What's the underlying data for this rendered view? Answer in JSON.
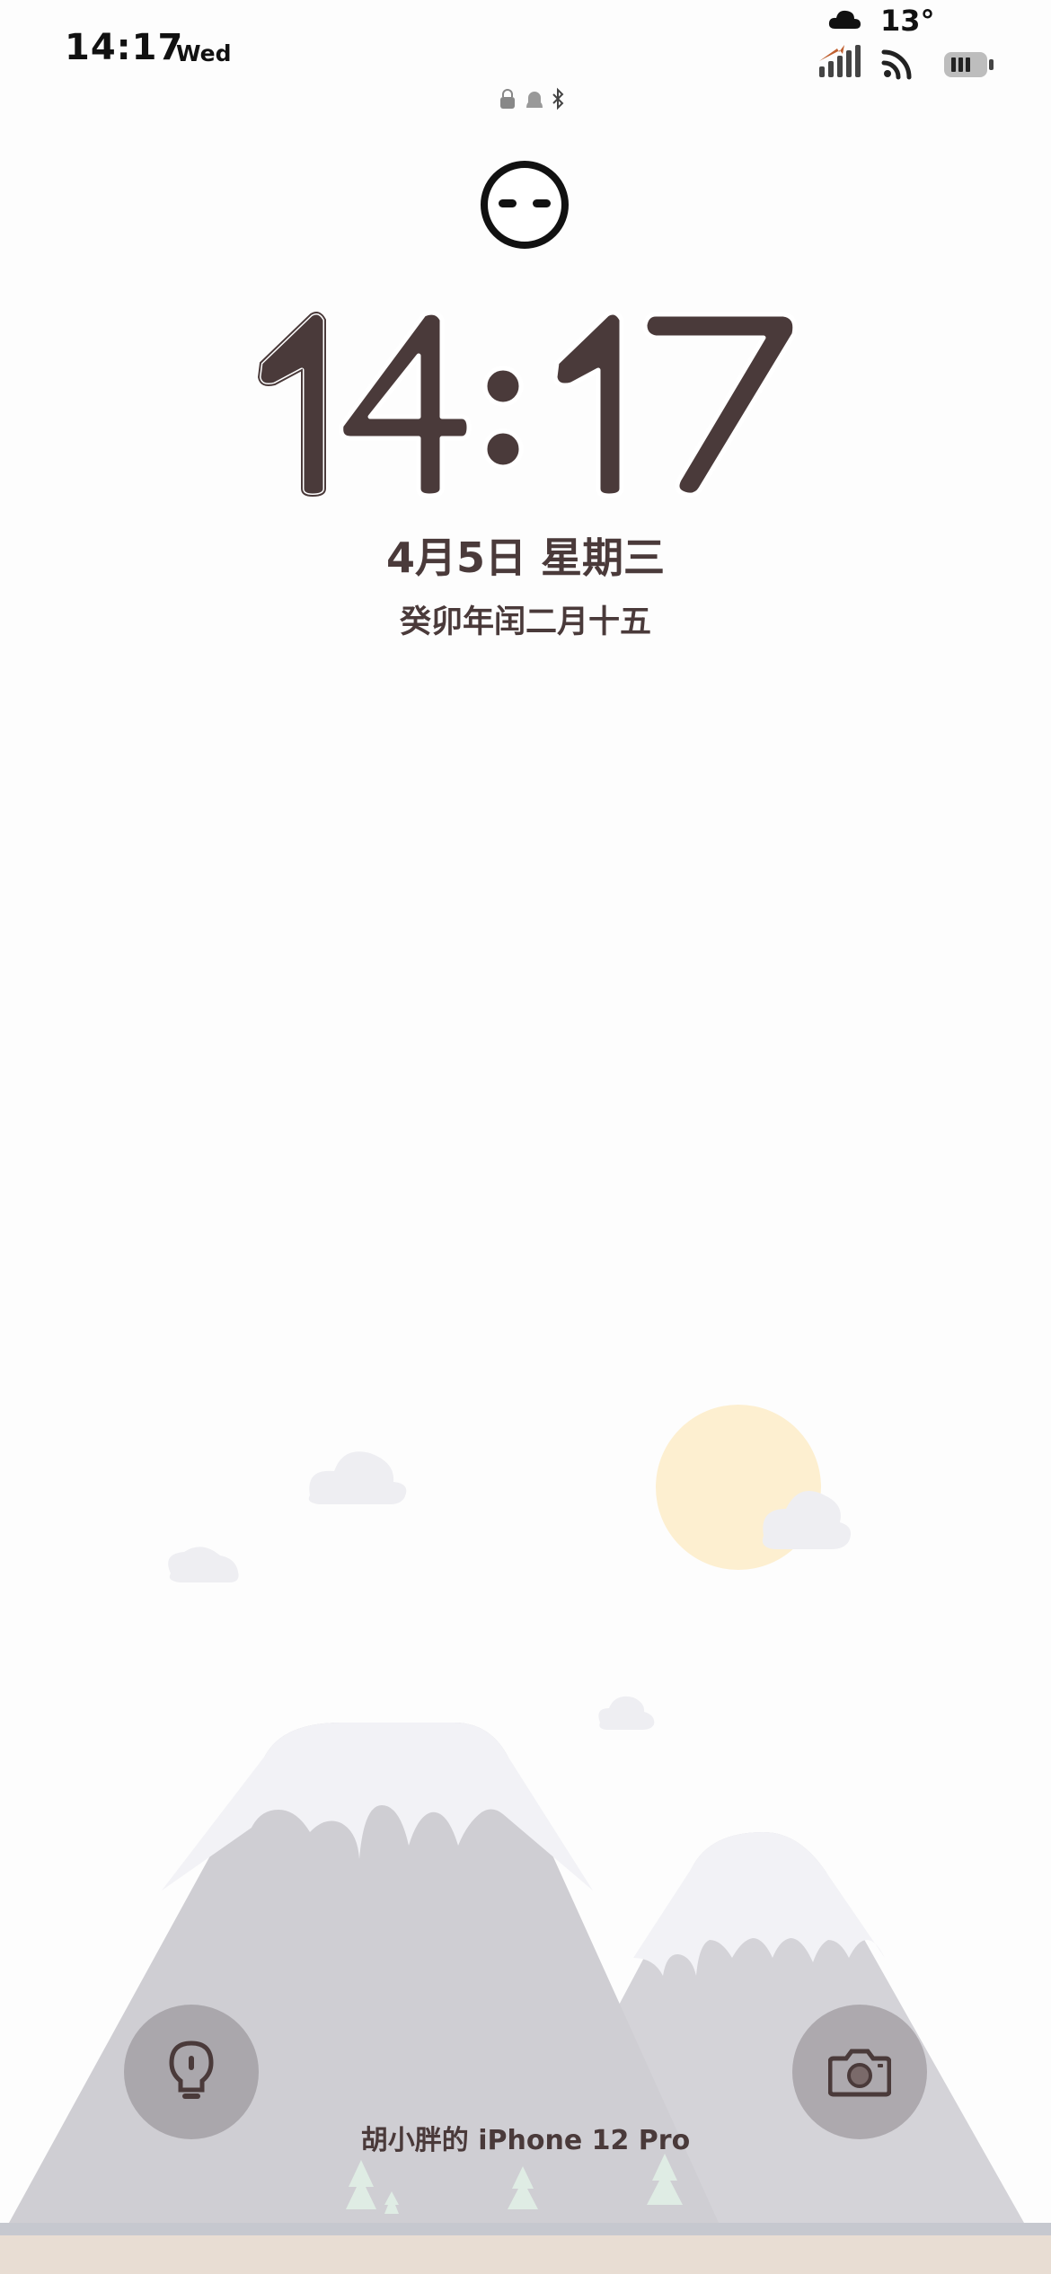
{
  "status_bar": {
    "time": "14:17",
    "day": "Wed",
    "temperature": "13°",
    "weather_icon": "cloud-icon",
    "icons": [
      "signal-icon",
      "wifi-icon",
      "battery-icon"
    ]
  },
  "indicator_icons": [
    "lock-icon",
    "bell-icon",
    "bluetooth-icon"
  ],
  "clock": {
    "digits": [
      "1",
      "4",
      ":",
      "1",
      "7"
    ],
    "color": "#4a3a3a"
  },
  "date_line": "4月5日 星期三",
  "lunar_date": "癸卯年闰二月十五",
  "quick_actions": {
    "flashlight_icon": "flashlight-icon",
    "camera_icon": "camera-icon"
  },
  "device_owner": "胡小胖的 iPhone 12 Pro",
  "colors": {
    "text": "#4a3a3a",
    "sun": "#fdefd0",
    "mountain": "#d3d2d6",
    "ground": "#e8ddd3"
  }
}
